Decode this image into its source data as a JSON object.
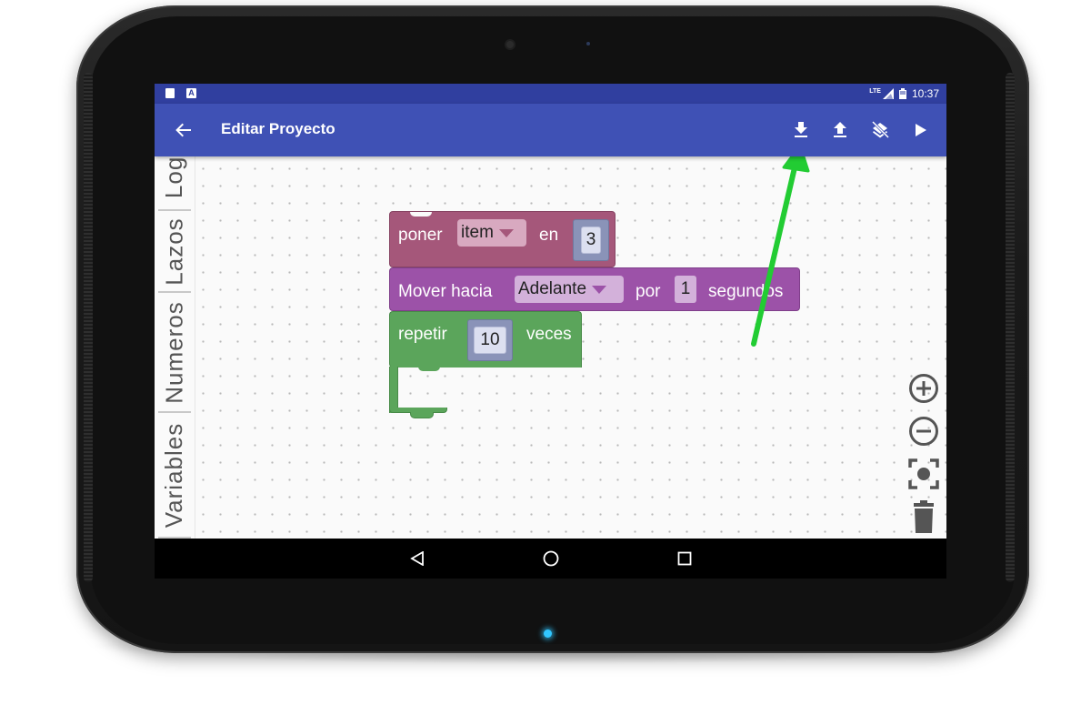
{
  "app_bar": {
    "title": "Editar Proyecto",
    "back_icon": "arrow-back-icon",
    "actions": [
      "download-icon",
      "upload-icon",
      "clear-layers-icon",
      "play-icon"
    ],
    "color": "#3f51b5"
  },
  "status_bar": {
    "time": "10:37",
    "network": "LTE",
    "color": "#303f9f"
  },
  "toolbox": {
    "categories": [
      "Logi",
      "Lazos",
      "Numeros",
      "Variables"
    ]
  },
  "blocks": {
    "set_block": {
      "label": "poner",
      "variable": "item",
      "mid_label": "en",
      "value": "3",
      "color": "#a5577a"
    },
    "move_block": {
      "label": "Mover hacia",
      "direction": "Adelante",
      "mid_label": "por",
      "value": "1",
      "end_label": "segundos",
      "color": "#9c52a8"
    },
    "repeat_block": {
      "label": "repetir",
      "value": "10",
      "end_label": "veces",
      "color": "#5ba55b"
    }
  },
  "workspace_controls": [
    "zoom-in-icon",
    "zoom-out-icon",
    "recenter-icon",
    "trash-icon"
  ],
  "nav_bar": [
    "back-triangle-icon",
    "home-circle-icon",
    "recents-square-icon"
  ],
  "annotation": {
    "color": "#22cc33"
  }
}
